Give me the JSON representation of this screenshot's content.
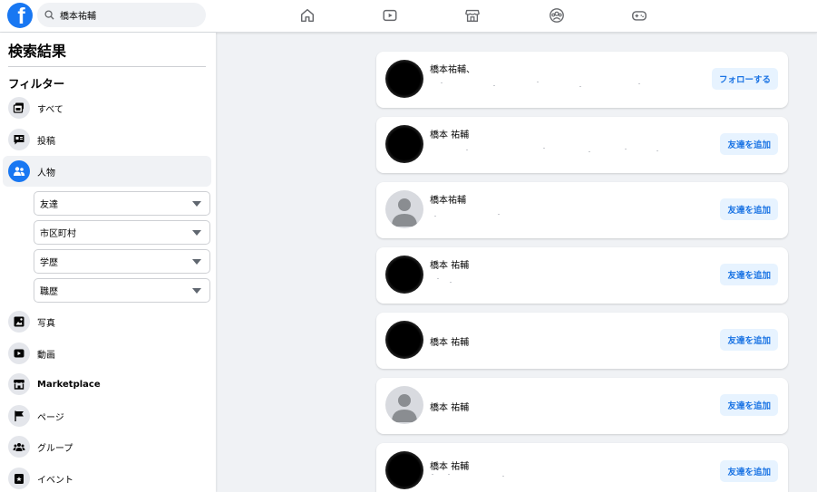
{
  "topbar": {
    "search_value": "橋本祐輔",
    "logo_letter": "f",
    "nav": [
      {
        "name": "home-icon"
      },
      {
        "name": "video-icon"
      },
      {
        "name": "marketplace-icon"
      },
      {
        "name": "groups-icon"
      },
      {
        "name": "gaming-icon"
      }
    ]
  },
  "sidebar": {
    "title": "検索結果",
    "filter_heading": "フィルター",
    "items": [
      {
        "label": "すべて",
        "icon": "all-icon"
      },
      {
        "label": "投稿",
        "icon": "posts-icon"
      },
      {
        "label": "人物",
        "icon": "people-icon",
        "active": true
      },
      {
        "label": "写真",
        "icon": "photos-icon"
      },
      {
        "label": "動画",
        "icon": "videos-icon"
      },
      {
        "label": "Marketplace",
        "icon": "marketplace-icon"
      },
      {
        "label": "ページ",
        "icon": "pages-icon"
      },
      {
        "label": "グループ",
        "icon": "groups-icon"
      },
      {
        "label": "イベント",
        "icon": "events-icon"
      }
    ],
    "people_filters": [
      "友達",
      "市区町村",
      "学歴",
      "職歴"
    ]
  },
  "results": [
    {
      "name": "橋本祐輔、",
      "button": "フォローする",
      "avatar": "blurred"
    },
    {
      "name": "橋本 祐輔",
      "button": "友達を追加",
      "avatar": "blurred"
    },
    {
      "name": "橋本祐輔",
      "button": "友達を追加",
      "avatar": "default"
    },
    {
      "name": "橋本 祐輔",
      "button": "友達を追加",
      "avatar": "blurred"
    },
    {
      "name": "橋本 祐輔",
      "button": "友達を追加",
      "avatar": "blurred"
    },
    {
      "name": "橋本 祐輔",
      "button": "友達を追加",
      "avatar": "default"
    },
    {
      "name": "橋本 祐輔",
      "button": "友達を追加",
      "avatar": "blurred"
    }
  ],
  "colors": {
    "brand": "#1877f2",
    "button_bg": "#e7f3ff",
    "button_text": "#1b74e4",
    "page_bg": "#f0f2f5"
  }
}
